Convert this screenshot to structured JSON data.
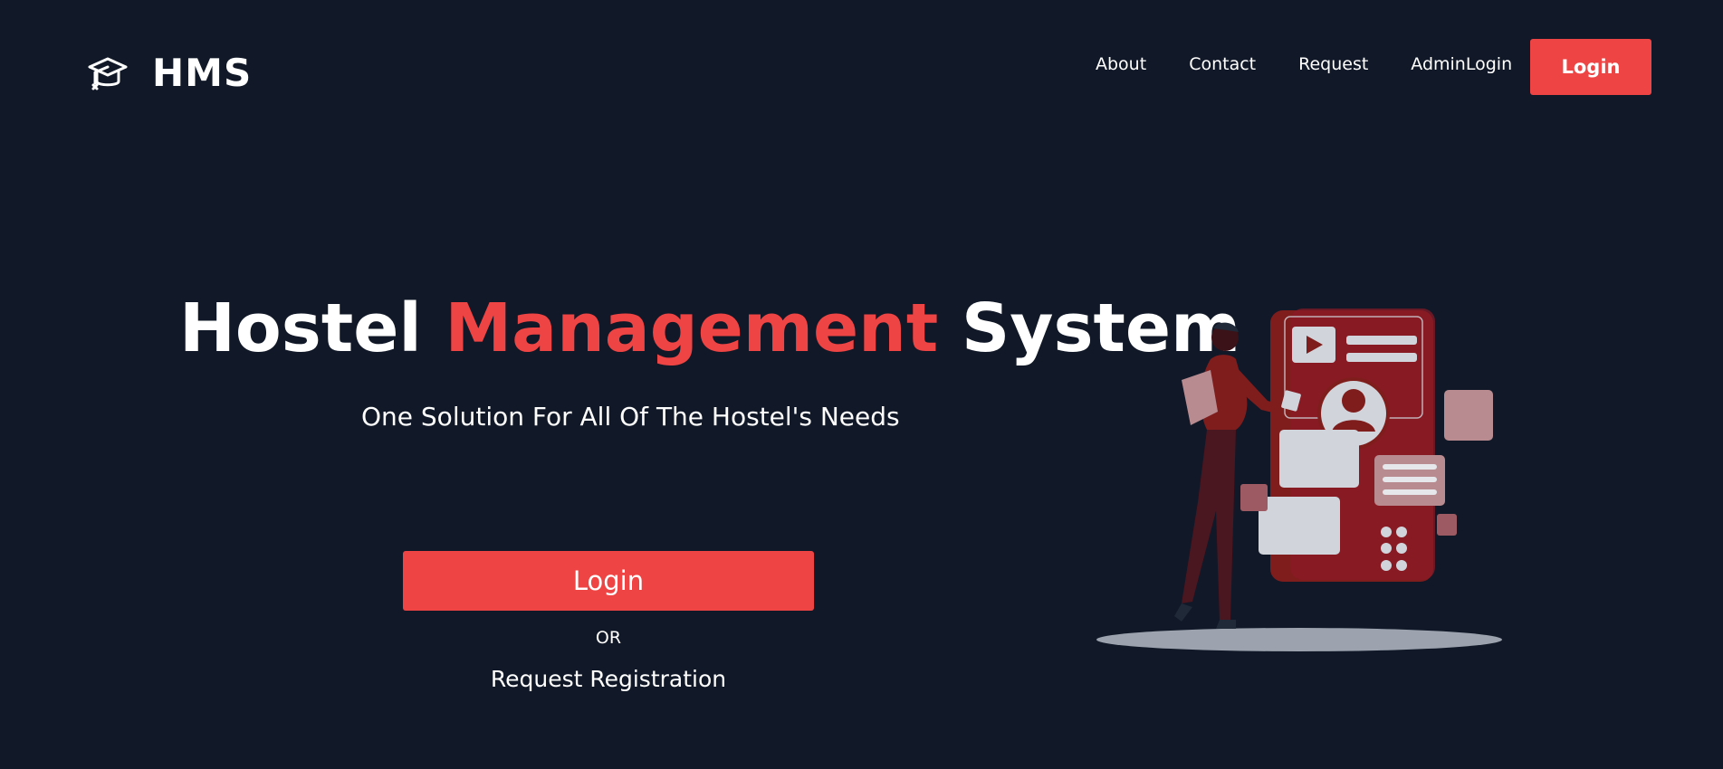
{
  "navbar": {
    "brand_icon": "graduation-cap-icon",
    "brand_name": "HMS",
    "links": [
      {
        "label": "About"
      },
      {
        "label": "Contact"
      },
      {
        "label": "Request"
      },
      {
        "label": "AdminLogin"
      }
    ],
    "login_label": "Login"
  },
  "hero": {
    "title_part1": "Hostel ",
    "title_accent": "Management",
    "title_part2": " System",
    "subtitle": "One Solution For All Of The Hostel's Needs",
    "login_label": "Login",
    "or_label": "OR",
    "register_label": "Request Registration"
  },
  "colors": {
    "background": "#111827",
    "accent": "#ef4444",
    "text": "#ffffff"
  }
}
